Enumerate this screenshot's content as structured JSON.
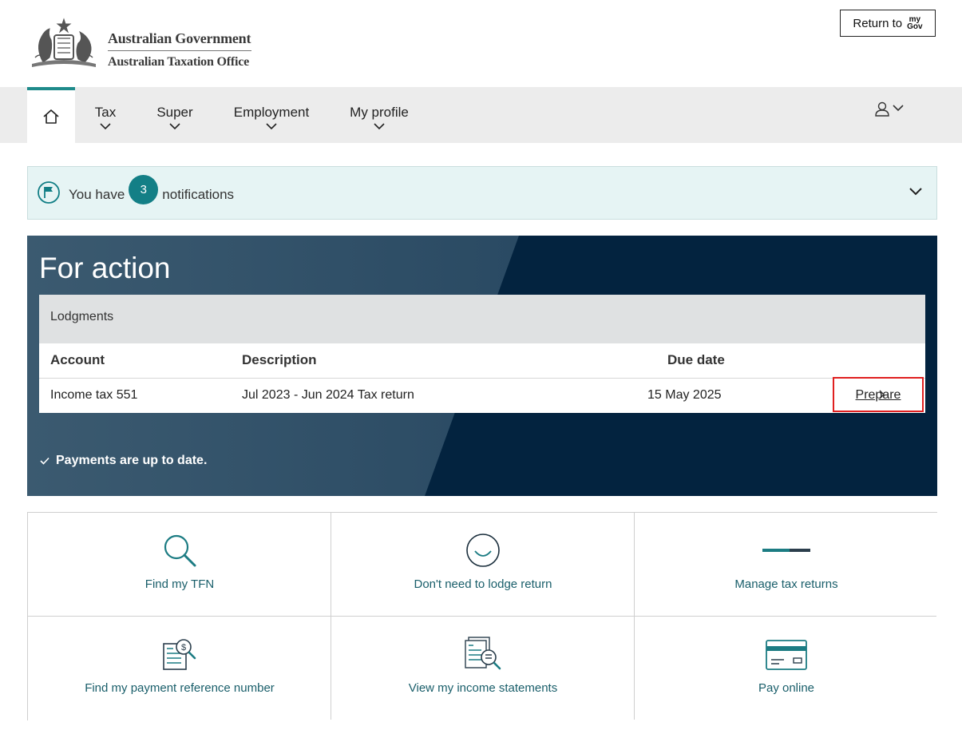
{
  "header": {
    "gov_line1": "Australian Government",
    "gov_line2": "Australian Taxation Office",
    "return_label": "Return to",
    "mygov_top": "my",
    "mygov_bottom": "Gov"
  },
  "nav": {
    "items": [
      {
        "label": "Tax"
      },
      {
        "label": "Super"
      },
      {
        "label": "Employment"
      },
      {
        "label": "My profile"
      }
    ],
    "accent": "#1e8a8a"
  },
  "notifications": {
    "prefix": "You have",
    "count": "3",
    "suffix": "notifications"
  },
  "for_action": {
    "title": "For action",
    "lodgments": {
      "heading": "Lodgments",
      "columns": [
        "Account",
        "Description",
        "Due date"
      ],
      "rows": [
        {
          "account": "Income tax 551",
          "description": "Jul 2023 - Jun 2024 Tax return",
          "due": "15 May 2025",
          "action": "Prepare"
        }
      ]
    },
    "payments_status": "Payments are up to date."
  },
  "tiles": [
    {
      "label": "Find my TFN",
      "icon": "search-icon"
    },
    {
      "label": "Don't need to lodge return",
      "icon": "smile-icon"
    },
    {
      "label": "Manage tax returns",
      "icon": "progress-icon"
    },
    {
      "label": "Find my payment reference number",
      "icon": "payment-reference-icon"
    },
    {
      "label": "View my income statements",
      "icon": "income-statement-icon"
    },
    {
      "label": "Pay online",
      "icon": "card-icon"
    }
  ],
  "colors": {
    "teal": "#137f86",
    "navy": "#03233f",
    "link": "#2a52be",
    "highlight": "#e02020"
  }
}
